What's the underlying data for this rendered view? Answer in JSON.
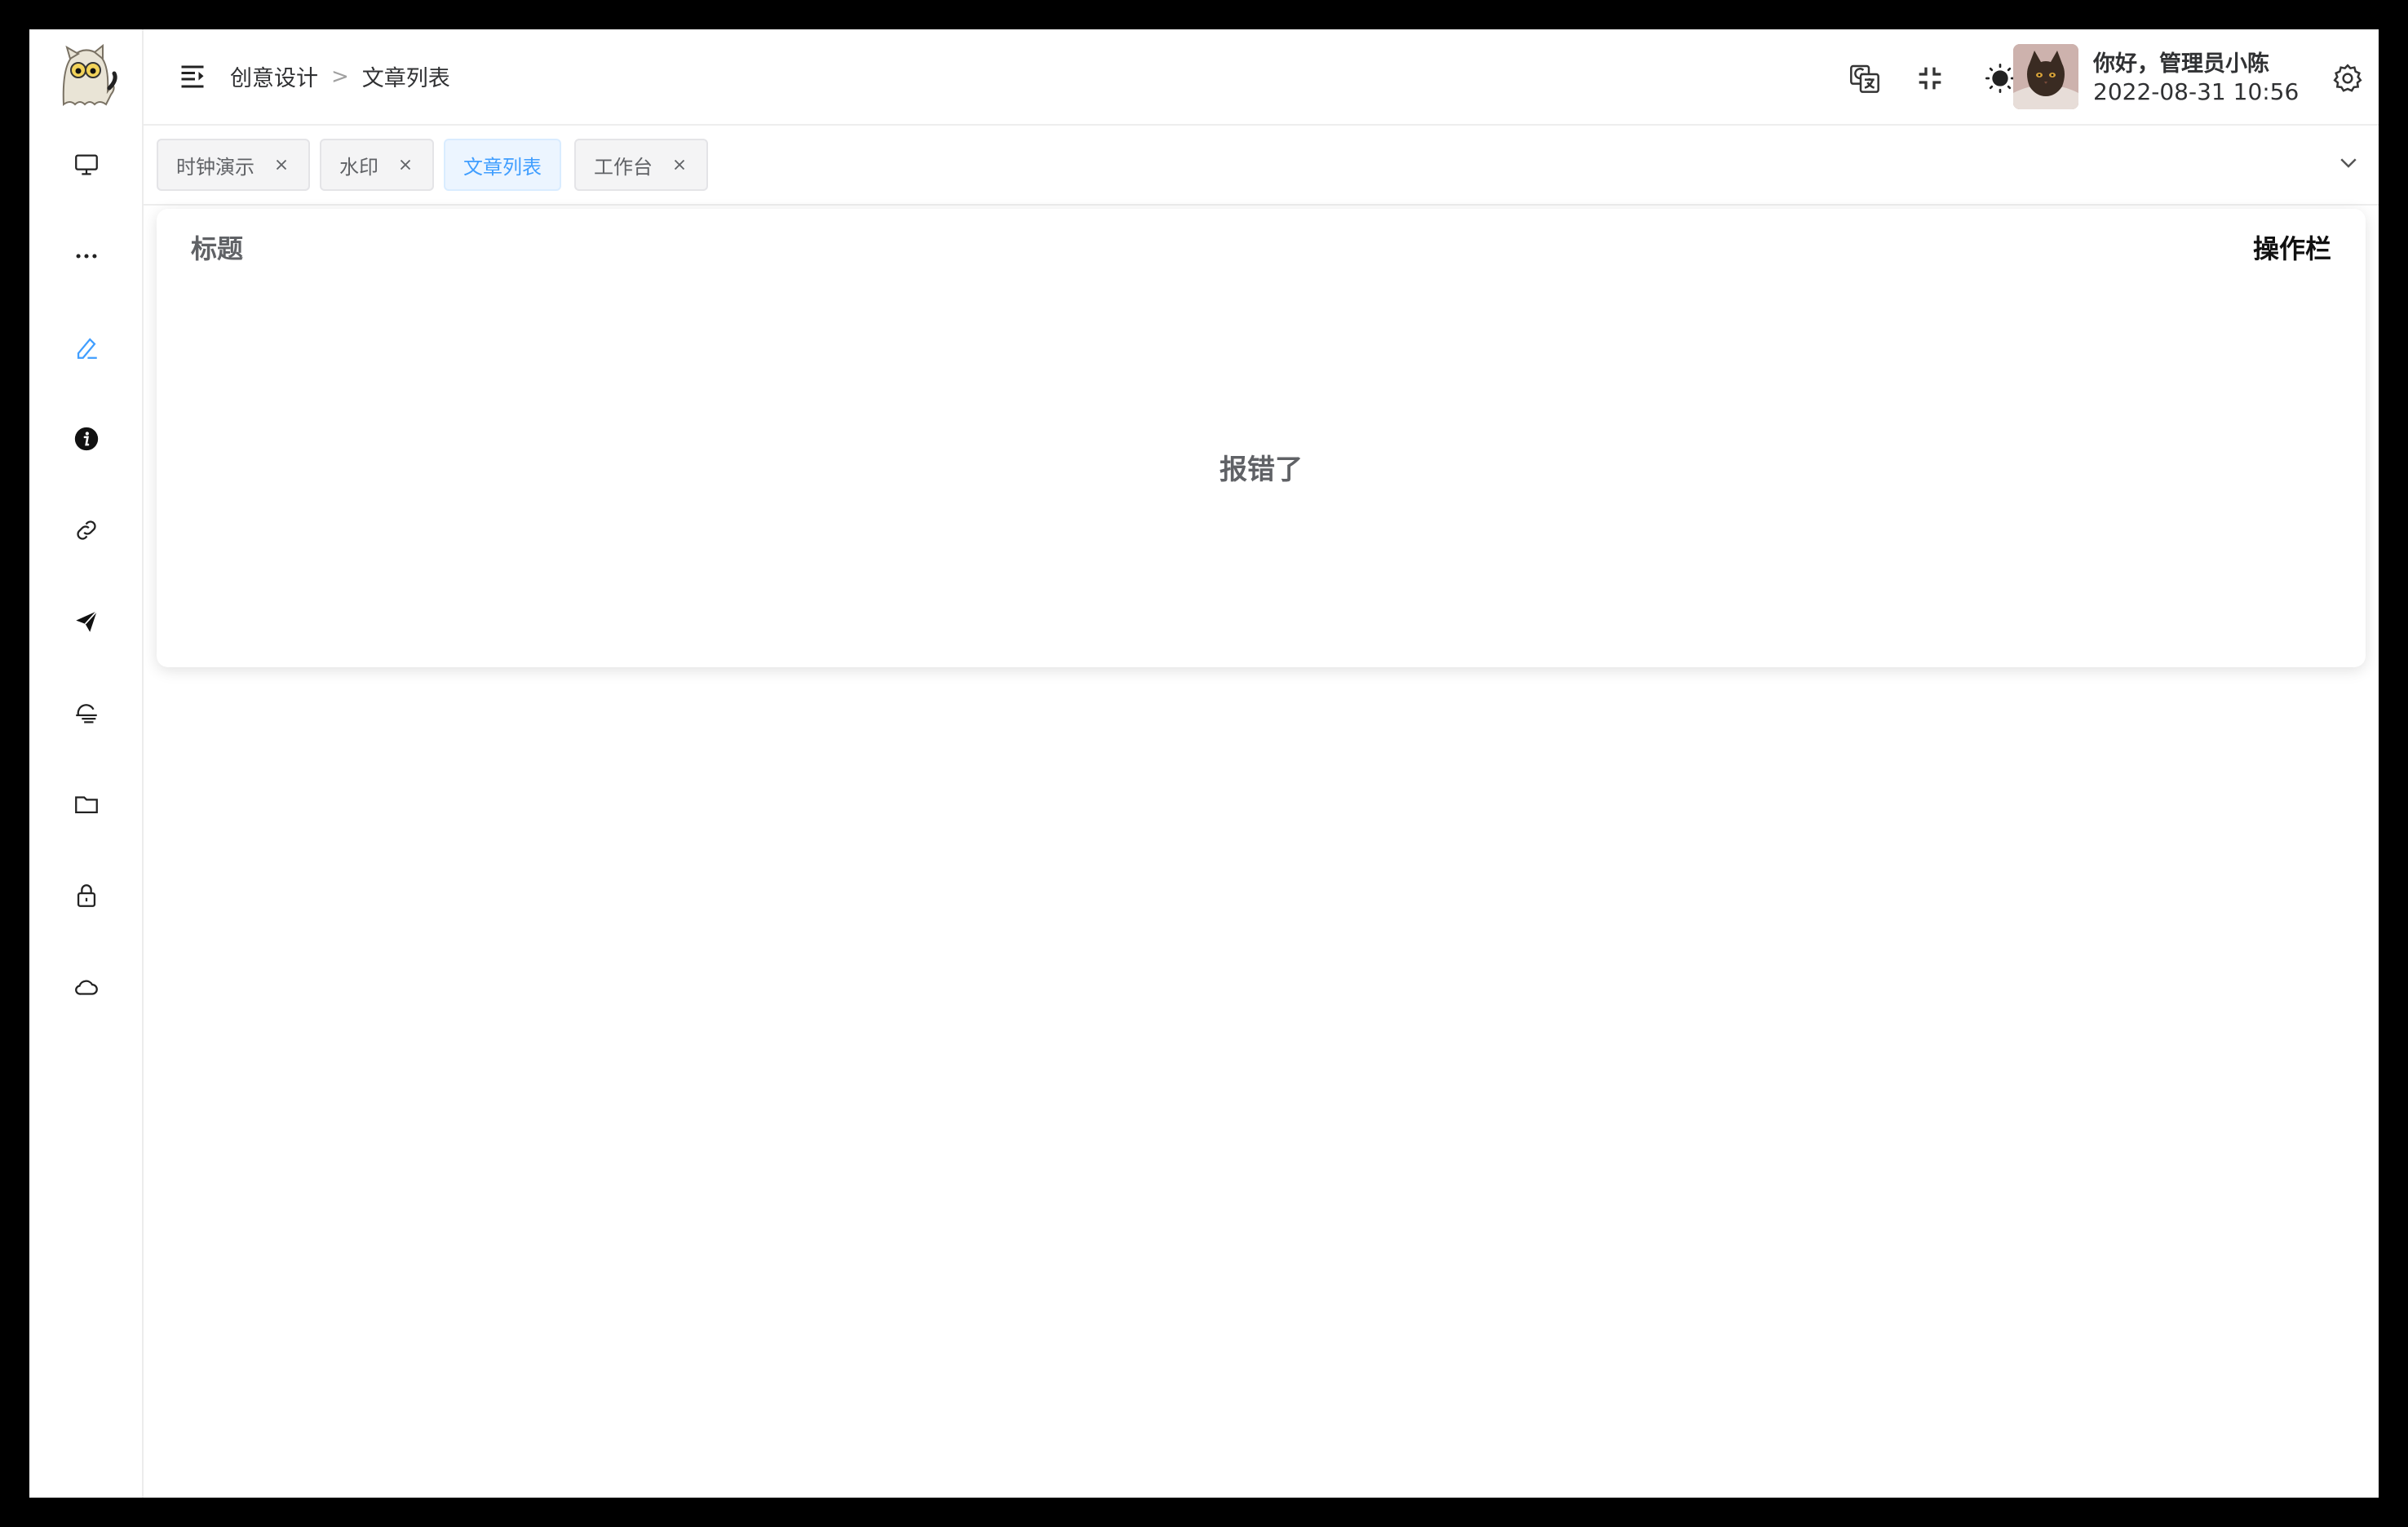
{
  "header": {
    "breadcrumb": [
      "创意设计",
      "文章列表"
    ],
    "user": {
      "greeting": "你好，管理员小陈",
      "datetime": "2022-08-31 10:56"
    }
  },
  "sidebar": {
    "items": [
      {
        "icon": "monitor-icon"
      },
      {
        "icon": "more-icon"
      },
      {
        "icon": "edit-pen-icon",
        "active": true
      },
      {
        "icon": "info-icon"
      },
      {
        "icon": "link-icon"
      },
      {
        "icon": "send-icon"
      },
      {
        "icon": "ice-cream-icon"
      },
      {
        "icon": "folder-icon"
      },
      {
        "icon": "lock-icon"
      },
      {
        "icon": "cloud-icon"
      }
    ]
  },
  "tabs": [
    {
      "label": "时钟演示",
      "closable": true,
      "active": false
    },
    {
      "label": "水印",
      "closable": true,
      "active": false
    },
    {
      "label": "文章列表",
      "closable": false,
      "active": true
    },
    {
      "label": "工作台",
      "closable": true,
      "active": false
    }
  ],
  "table": {
    "columns": [
      "标题",
      "操作栏"
    ],
    "empty_text": "报错了"
  },
  "colors": {
    "accent": "#409eff",
    "text_primary": "#303133",
    "text_secondary": "#606266"
  }
}
